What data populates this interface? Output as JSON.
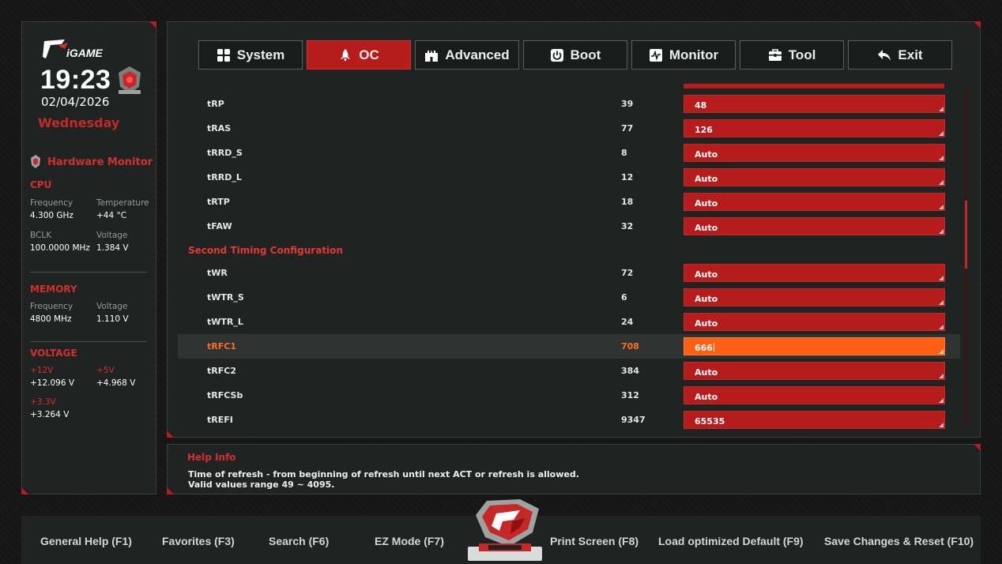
{
  "sidebar": {
    "brand": "iGAME",
    "time": "19:23",
    "date": "02/04/2026",
    "weekday": "Wednesday",
    "hardware_monitor_title": "Hardware Monitor",
    "cpu": {
      "heading": "CPU",
      "frequency_label": "Frequency",
      "frequency_value": "4.300 GHz",
      "temperature_label": "Temperature",
      "temperature_value": "+44 °C",
      "bclk_label": "BCLK",
      "bclk_value": "100.0000 MHz",
      "voltage_label": "Voltage",
      "voltage_value": "1.384 V"
    },
    "memory": {
      "heading": "MEMORY",
      "frequency_label": "Frequency",
      "frequency_value": "4800 MHz",
      "voltage_label": "Voltage",
      "voltage_value": "1.110 V"
    },
    "voltage": {
      "heading": "VOLTAGE",
      "v12_label": "+12V",
      "v12_value": "+12.096 V",
      "v5_label": "+5V",
      "v5_value": "+4.968 V",
      "v33_label": "+3.3V",
      "v33_value": "+3.264 V"
    }
  },
  "tabs": [
    {
      "label": "System",
      "icon": "grid-icon"
    },
    {
      "label": "OC",
      "icon": "rocket-icon",
      "active": true
    },
    {
      "label": "Advanced",
      "icon": "castle-icon"
    },
    {
      "label": "Boot",
      "icon": "power-icon"
    },
    {
      "label": "Monitor",
      "icon": "pulse-icon"
    },
    {
      "label": "Tool",
      "icon": "toolbox-icon"
    },
    {
      "label": "Exit",
      "icon": "back-arrow-icon"
    }
  ],
  "timings_top": [
    {
      "name": "tRP",
      "current": "39",
      "value": "48"
    },
    {
      "name": "tRAS",
      "current": "77",
      "value": "126"
    },
    {
      "name": "tRRD_S",
      "current": "8",
      "value": "Auto"
    },
    {
      "name": "tRRD_L",
      "current": "12",
      "value": "Auto"
    },
    {
      "name": "tRTP",
      "current": "18",
      "value": "Auto"
    },
    {
      "name": "tFAW",
      "current": "32",
      "value": "Auto"
    }
  ],
  "second_group_title": "Second Timing Configuration",
  "timings_second": [
    {
      "name": "tWR",
      "current": "72",
      "value": "Auto"
    },
    {
      "name": "tWTR_S",
      "current": "6",
      "value": "Auto"
    },
    {
      "name": "tWTR_L",
      "current": "24",
      "value": "Auto"
    },
    {
      "name": "tRFC1",
      "current": "708",
      "value": "666",
      "selected": true
    },
    {
      "name": "tRFC2",
      "current": "384",
      "value": "Auto"
    },
    {
      "name": "tRFCSb",
      "current": "312",
      "value": "Auto"
    },
    {
      "name": "tREFI",
      "current": "9347",
      "value": "65535"
    }
  ],
  "help": {
    "title": "Help Info",
    "line1": "Time of refresh - from beginning of refresh until next ACT or refresh is allowed.",
    "line2": "Valid values range 49 ~ 4095."
  },
  "footer": {
    "general_help": "General Help (F1)",
    "favorites": "Favorites (F3)",
    "search": "Search (F6)",
    "ez_mode": "EZ Mode (F7)",
    "print_screen": "Print Screen (F8)",
    "load_default": "Load optimized Default (F9)",
    "save_reset": "Save Changes & Reset (F10)"
  },
  "colors": {
    "accent": "#b71c1c",
    "selected": "#ff5f15",
    "panel": "#1f2321"
  }
}
